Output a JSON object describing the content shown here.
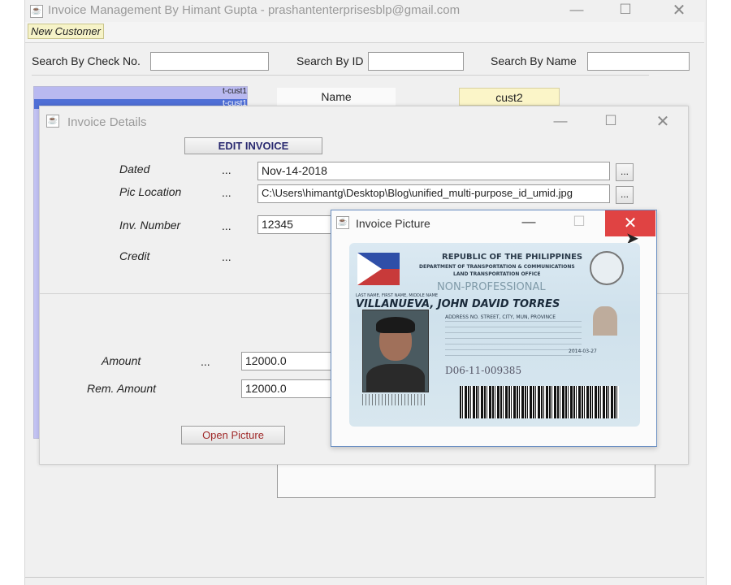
{
  "main": {
    "title": "Invoice Management By Himant Gupta - prashantenterprisesblp@gmail.com",
    "menu": "New Customer",
    "search_check_label": "Search By Check No.",
    "search_id_label": "Search By ID",
    "search_name_label": "Search By Name",
    "name_header": "Name",
    "name_value": "cust2",
    "list_items": [
      "t-cust1",
      "t-cust1"
    ]
  },
  "details": {
    "title": "Invoice Details",
    "edit_button": "EDIT INVOICE",
    "dated_label": "Dated",
    "pic_location_label": "Pic Location",
    "inv_number_label": "Inv. Number",
    "credit_label": "Credit",
    "amount_label": "Amount",
    "rem_amount_label": "Rem. Amount",
    "dots": "...",
    "dated_value": "Nov-14-2018",
    "pic_location_value": "C:\\Users\\himantg\\Desktop\\Blog\\unified_multi-purpose_id_umid.jpg",
    "inv_number_value": "12345",
    "amount_value": "12000.0",
    "rem_amount_value": "12000.0",
    "browse_label": "...",
    "open_picture_button": "Open Picture"
  },
  "picture": {
    "title": "Invoice Picture",
    "card": {
      "republic": "REPUBLIC OF THE PHILIPPINES",
      "department": "DEPARTMENT OF TRANSPORTATION & COMMUNICATIONS",
      "office": "LAND TRANSPORTATION OFFICE",
      "category": "NON-PROFESSIONAL",
      "name_caption": "LAST NAME, FIRST NAME, MIDDLE NAME",
      "name": "VILLANUEVA, JOHN DAVID TORRES",
      "address": "ADDRESS NO. STREET, CITY, MUN, PROVINCE",
      "license_no": "D06-11-009385",
      "expiry": "2014-03-27"
    }
  },
  "colors": {
    "accent_close": "#e04343",
    "menu_bg": "#f6f3c8",
    "list_bg": "#b9b9f0",
    "name_value_bg": "#fbf5c8"
  }
}
